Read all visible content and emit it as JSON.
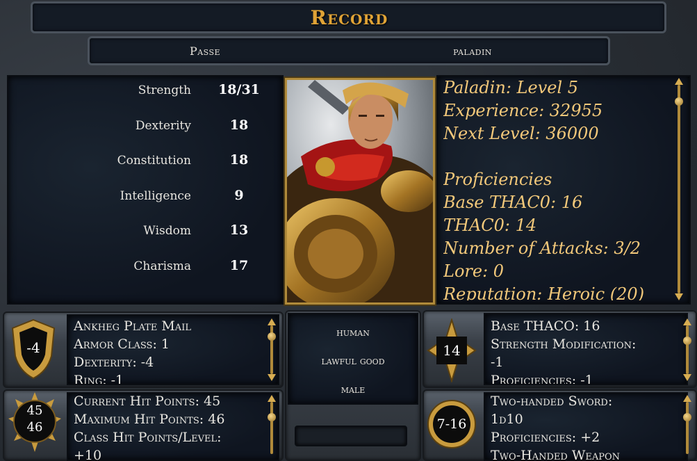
{
  "title": "Record",
  "character": {
    "name": "Passe",
    "class_name": "paladin"
  },
  "stats": [
    {
      "label": "Strength",
      "value": "18/31"
    },
    {
      "label": "Dexterity",
      "value": "18"
    },
    {
      "label": "Constitution",
      "value": "18"
    },
    {
      "label": "Intelligence",
      "value": "9"
    },
    {
      "label": "Wisdom",
      "value": "13"
    },
    {
      "label": "Charisma",
      "value": "17"
    }
  ],
  "info_lines": [
    "Paladin: Level 5",
    "Experience: 32955",
    "Next Level: 36000",
    "",
    "Proficiencies",
    "Base THAC0: 16",
    "THAC0: 14",
    "Number of Attacks: 3/2",
    "Lore: 0",
    "Reputation: Heroic (20)"
  ],
  "armor": {
    "badge": "-4",
    "lines": [
      "Ankheg Plate Mail",
      "Armor Class: 1",
      "Dexterity: -4",
      "Ring: -1"
    ]
  },
  "hp": {
    "current": "45",
    "max": "46",
    "lines": [
      "Current Hit Points: 45",
      "Maximum Hit Points: 46",
      "Class Hit Points/Level:",
      "+10"
    ]
  },
  "identity": {
    "race": "human",
    "alignment": "lawful good",
    "gender": "male"
  },
  "thac0": {
    "badge": "14",
    "lines": [
      "Base THACO: 16",
      "Strength Modification:",
      "-1",
      "Proficiencies: -1"
    ]
  },
  "damage": {
    "badge": "7-16",
    "lines": [
      "Two-handed Sword:",
      "1d10",
      "Proficiencies: +2",
      "Two-Handed Weapon"
    ]
  },
  "colors": {
    "gold": "#e0a336",
    "info_text": "#f2c87a",
    "panel": "#121a24"
  }
}
